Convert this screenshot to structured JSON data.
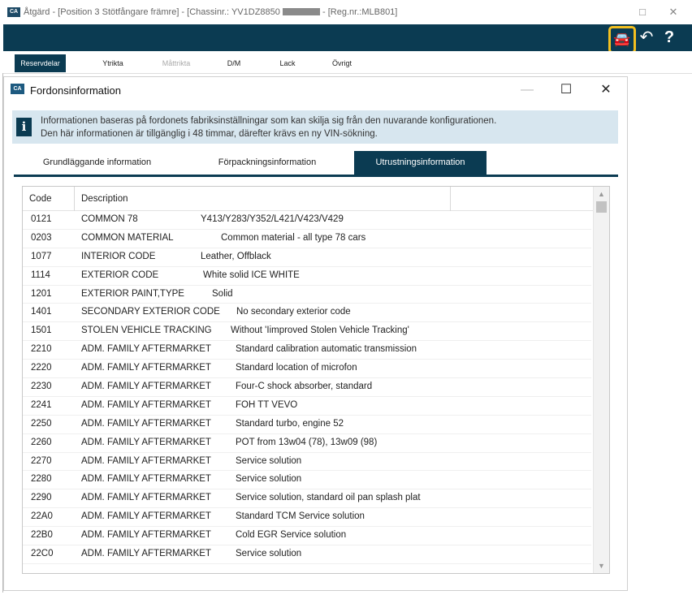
{
  "window": {
    "title_prefix": "Åtgärd - [Position 3 Stötfångare främre] - [Chassinr.: YV1DZ8850",
    "title_suffix": "- [Reg.nr.:MLB801]",
    "app_icon": "CA",
    "maximize_icon": "□",
    "close_icon": "✕"
  },
  "header": {
    "vehicle_icon": "car-info-icon",
    "vehicle_glyph": "🚘",
    "back_glyph": "↶",
    "help_glyph": "?",
    "highlight_color": "#f4c020"
  },
  "app_tabs": [
    {
      "label": "Reservdelar",
      "state": "active"
    },
    {
      "label": "Ytrikta",
      "state": "normal"
    },
    {
      "label": "Måttrikta",
      "state": "disabled"
    },
    {
      "label": "D/M",
      "state": "normal"
    },
    {
      "label": "Lack",
      "state": "normal"
    },
    {
      "label": "Övrigt",
      "state": "normal"
    }
  ],
  "dialog": {
    "icon": "CA",
    "title": "Fordonsinformation",
    "min_glyph": "—",
    "max_glyph": "☐",
    "close_glyph": "✕",
    "info_glyph": "i",
    "info_line1": "Informationen baseras på fordonets fabriksinställningar som kan skilja sig från den nuvarande konfigurationen.",
    "info_line2": "Den här informationen är tillgänglig i 48 timmar, därefter krävs en ny VIN-sökning.",
    "tabs": [
      {
        "label": "Grundläggande information"
      },
      {
        "label": "Förpackningsinformation"
      },
      {
        "label": "Utrustningsinformation"
      }
    ],
    "active_tab": 2
  },
  "table": {
    "headers": {
      "code": "Code",
      "description": "Description"
    },
    "scroll_up": "▲",
    "scroll_down": "▼",
    "rows": [
      {
        "code": "0121",
        "desc": "COMMON 78",
        "value": "Y413/Y283/Y352/L421/V423/V429"
      },
      {
        "code": "0203",
        "desc": "COMMON MATERIAL",
        "value": "Common material - all type 78 cars"
      },
      {
        "code": "1077",
        "desc": "INTERIOR CODE",
        "value": "Leather, Offblack"
      },
      {
        "code": "1114",
        "desc": "EXTERIOR CODE",
        "value": "White solid ICE WHITE"
      },
      {
        "code": "1201",
        "desc": "EXTERIOR PAINT,TYPE",
        "value": "Solid"
      },
      {
        "code": "1401",
        "desc": "SECONDARY EXTERIOR CODE",
        "value": "No secondary exterior code"
      },
      {
        "code": "1501",
        "desc": "STOLEN VEHICLE TRACKING",
        "value": "Without 'Iimproved Stolen Vehicle Tracking'"
      },
      {
        "code": "2210",
        "desc": "ADM. FAMILY AFTERMARKET",
        "value": "Standard calibration automatic transmission"
      },
      {
        "code": "2220",
        "desc": "ADM. FAMILY AFTERMARKET",
        "value": "Standard location of microfon"
      },
      {
        "code": "2230",
        "desc": "ADM. FAMILY AFTERMARKET",
        "value": "Four-C shock absorber, standard"
      },
      {
        "code": "2241",
        "desc": "ADM. FAMILY AFTERMARKET",
        "value": "FOH TT VEVO"
      },
      {
        "code": "2250",
        "desc": "ADM. FAMILY AFTERMARKET",
        "value": "Standard turbo, engine 52"
      },
      {
        "code": "2260",
        "desc": "ADM. FAMILY AFTERMARKET",
        "value": "POT from 13w04 (78), 13w09 (98)"
      },
      {
        "code": "2270",
        "desc": "ADM. FAMILY AFTERMARKET",
        "value": "Service solution"
      },
      {
        "code": "2280",
        "desc": "ADM. FAMILY AFTERMARKET",
        "value": "Service solution"
      },
      {
        "code": "2290",
        "desc": "ADM. FAMILY AFTERMARKET",
        "value": "Service solution, standard oil pan splash plat"
      },
      {
        "code": "22A0",
        "desc": "ADM. FAMILY AFTERMARKET",
        "value": "Standard TCM Service solution"
      },
      {
        "code": "22B0",
        "desc": "ADM. FAMILY AFTERMARKET",
        "value": "Cold EGR Service solution"
      },
      {
        "code": "22C0",
        "desc": "ADM. FAMILY AFTERMARKET",
        "value": "Service solution"
      }
    ]
  }
}
